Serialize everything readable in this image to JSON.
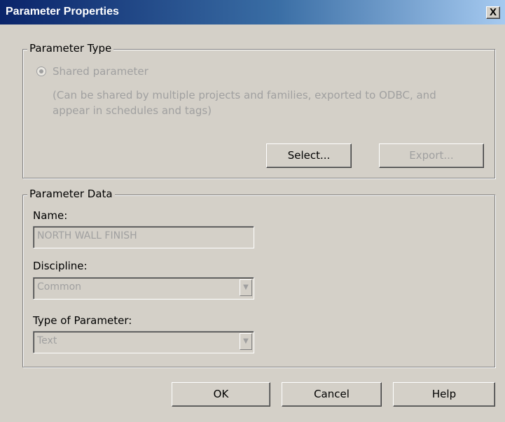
{
  "window": {
    "title": "Parameter Properties",
    "close_glyph": "X"
  },
  "parameter_type": {
    "legend": "Parameter Type",
    "shared_radio_label": "Shared parameter",
    "description_line1": "(Can be shared by multiple projects and families, exported to ODBC, and",
    "description_line2": "appear in schedules and tags)",
    "select_label": "Select...",
    "export_label": "Export..."
  },
  "parameter_data": {
    "legend": "Parameter Data",
    "name_label": "Name:",
    "name_value": "NORTH WALL FINISH",
    "discipline_label": "Discipline:",
    "discipline_value": "Common",
    "type_label": "Type of Parameter:",
    "type_value": "Text"
  },
  "buttons": {
    "ok": "OK",
    "cancel": "Cancel",
    "help": "Help"
  }
}
